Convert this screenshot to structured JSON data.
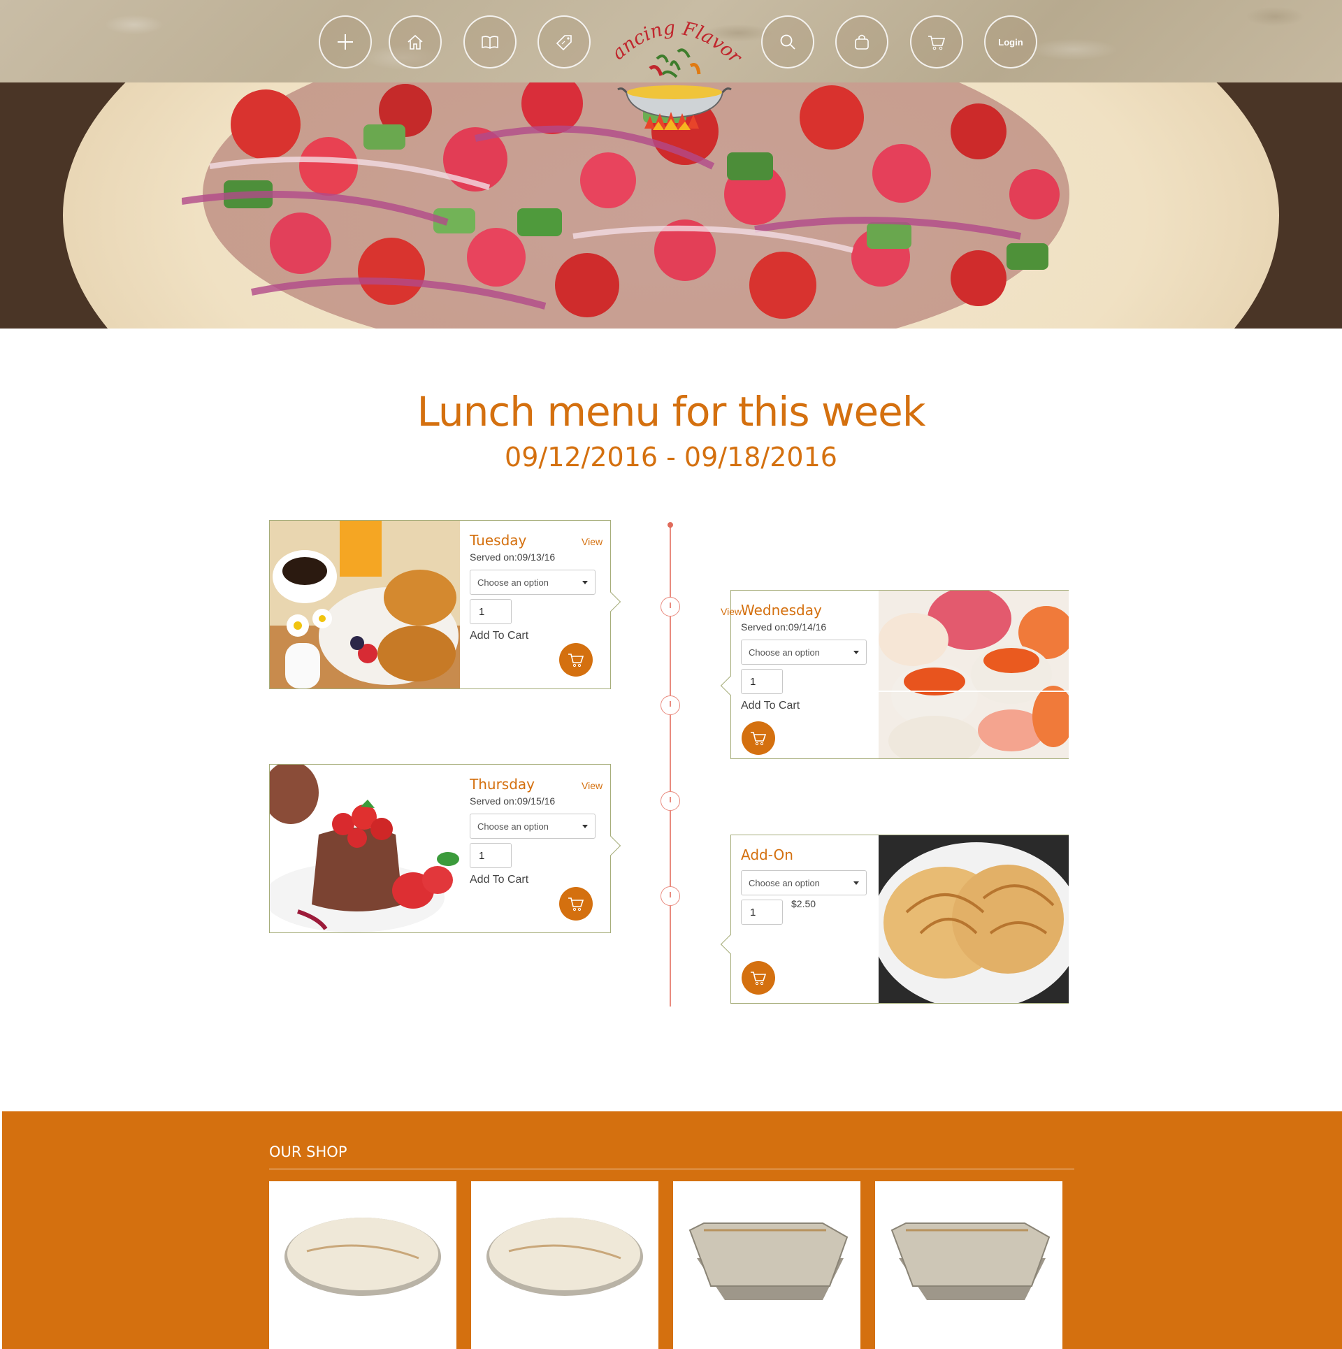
{
  "header": {
    "logo_text": "Dancing Flavors",
    "nav": [
      {
        "icon": "plus-icon",
        "label": ""
      },
      {
        "icon": "home-icon",
        "label": ""
      },
      {
        "icon": "book-icon",
        "label": ""
      },
      {
        "icon": "tag-icon",
        "label": ""
      },
      {
        "icon": "search-icon",
        "label": ""
      },
      {
        "icon": "bag-icon",
        "label": ""
      },
      {
        "icon": "cart-icon",
        "label": ""
      },
      {
        "icon": "login",
        "label": "Login"
      }
    ]
  },
  "main": {
    "title": "Lunch menu for this week",
    "date_range": "09/12/2016 - 09/18/2016"
  },
  "menu": [
    {
      "day": "Tuesday",
      "view": "View",
      "served": "Served on:09/13/16",
      "select_placeholder": "Choose an option",
      "qty": "1",
      "add_label": "Add To Cart",
      "image": "breakfast-croissants-coffee"
    },
    {
      "day": "Wednesday",
      "view": "View",
      "served": "Served on:09/14/16",
      "select_placeholder": "Choose an option",
      "qty": "1",
      "add_label": "Add To Cart",
      "image": "sushi-rolls"
    },
    {
      "day": "Thursday",
      "view": "View",
      "served": "Served on:09/15/16",
      "select_placeholder": "Choose an option",
      "qty": "1",
      "add_label": "Add To Cart",
      "image": "chocolate-mousse-strawberries"
    },
    {
      "day": "Add-On",
      "select_placeholder": "Choose an option",
      "qty": "1",
      "price": "$2.50",
      "image": "paratha-flatbread"
    }
  ],
  "shop": {
    "title": "OUR SHOP",
    "items": [
      {
        "image": "round-palm-leaf-plate"
      },
      {
        "image": "round-palm-leaf-plate"
      },
      {
        "image": "rectangular-palm-leaf-tray"
      },
      {
        "image": "rectangular-palm-leaf-tray"
      }
    ]
  },
  "colors": {
    "accent": "#d4700f",
    "card_border": "#a6ad7a",
    "timeline": "#e98b7f",
    "header_bg": "#c2b59c"
  }
}
